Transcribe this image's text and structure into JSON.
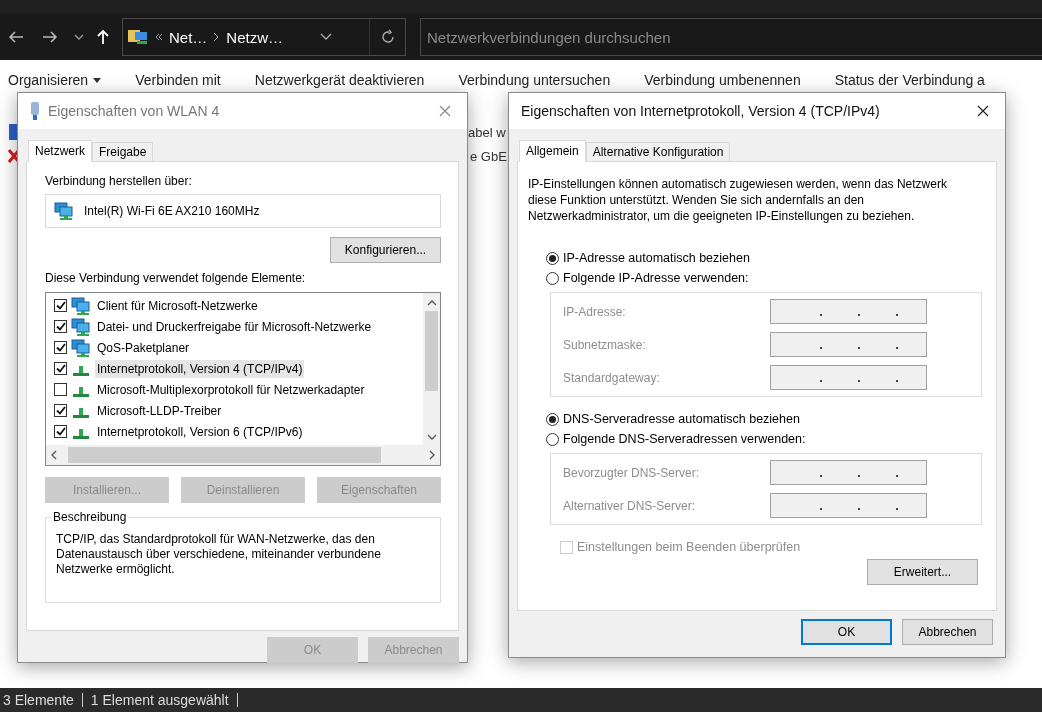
{
  "explorer": {
    "nav": {
      "breadcrumb": [
        "Net…",
        "Netzw…"
      ],
      "search_placeholder": "Netzwerkverbindungen durchsuchen"
    },
    "toolbar": [
      {
        "label": "Organisieren",
        "dropdown": true
      },
      {
        "label": "Verbinden mit",
        "dropdown": false
      },
      {
        "label": "Netzwerkgerät deaktivieren",
        "dropdown": false
      },
      {
        "label": "Verbindung untersuchen",
        "dropdown": false
      },
      {
        "label": "Verbindung umbenennen",
        "dropdown": false
      },
      {
        "label": "Status der Verbindung a",
        "dropdown": false
      }
    ],
    "file_list": [
      {
        "text": "abel w",
        "kind": "adapter"
      },
      {
        "text": "e GbE",
        "kind": "error"
      }
    ],
    "status_bar": [
      "3 Elemente",
      "1 Element ausgewählt"
    ]
  },
  "wlan_dialog": {
    "title": "Eigenschaften von WLAN 4",
    "tabs": [
      {
        "label": "Netzwerk",
        "selected": true
      },
      {
        "label": "Freigabe",
        "selected": false
      }
    ],
    "connect_label": "Verbindung herstellen über:",
    "adapter": "Intel(R) Wi-Fi 6E AX210 160MHz",
    "configure_button": "Konfigurieren...",
    "items_label": "Diese Verbindung verwendet folgende Elemente:",
    "items": [
      {
        "label": "Client für Microsoft-Netzwerke",
        "checked": true,
        "selected": false,
        "kind": "client"
      },
      {
        "label": "Datei- und Druckerfreigabe für Microsoft-Netzwerke",
        "checked": true,
        "selected": false,
        "kind": "service"
      },
      {
        "label": "QoS-Paketplaner",
        "checked": true,
        "selected": false,
        "kind": "service"
      },
      {
        "label": "Internetprotokoll, Version 4 (TCP/IPv4)",
        "checked": true,
        "selected": true,
        "kind": "protocol"
      },
      {
        "label": "Microsoft-Multiplexorprotokoll für Netzwerkadapter",
        "checked": false,
        "selected": false,
        "kind": "protocol"
      },
      {
        "label": "Microsoft-LLDP-Treiber",
        "checked": true,
        "selected": false,
        "kind": "protocol"
      },
      {
        "label": "Internetprotokoll, Version 6 (TCP/IPv6)",
        "checked": true,
        "selected": false,
        "kind": "protocol"
      }
    ],
    "action_buttons": [
      {
        "label": "Installieren...",
        "disabled": true
      },
      {
        "label": "Deinstallieren",
        "disabled": true
      },
      {
        "label": "Eigenschaften",
        "disabled": true
      }
    ],
    "description_title": "Beschreibung",
    "description": "TCP/IP, das Standardprotokoll für WAN-Netzwerke, das den Datenaustausch über verschiedene, miteinander verbundene Netzwerke ermöglicht.",
    "footer_buttons": [
      {
        "label": "OK",
        "disabled": true
      },
      {
        "label": "Abbrechen",
        "disabled": true
      }
    ]
  },
  "ipv4_dialog": {
    "title": "Eigenschaften von Internetprotokoll, Version 4 (TCP/IPv4)",
    "tabs": [
      {
        "label": "Allgemein",
        "selected": true
      },
      {
        "label": "Alternative Konfiguration",
        "selected": false
      }
    ],
    "intro": "IP-Einstellungen können automatisch zugewiesen werden, wenn das Netzwerk diese Funktion unterstützt. Wenden Sie sich andernfalls an den Netzwerkadministrator, um die geeigneten IP-Einstellungen zu beziehen.",
    "groups": [
      {
        "auto": {
          "label": "IP-Adresse automatisch beziehen",
          "selected": true
        },
        "manual": {
          "label": "Folgende IP-Adresse verwenden:",
          "selected": false
        },
        "disabled": true,
        "fields": [
          "IP-Adresse:",
          "Subnetzmaske:",
          "Standardgateway:"
        ]
      },
      {
        "auto": {
          "label": "DNS-Serveradresse automatisch beziehen",
          "selected": true
        },
        "manual": {
          "label": "Folgende DNS-Serveradressen verwenden:",
          "selected": false
        },
        "disabled": true,
        "fields": [
          "Bevorzugter DNS-Server:",
          "Alternativer DNS-Server:"
        ]
      }
    ],
    "validate": {
      "label": "Einstellungen beim Beenden überprüfen",
      "checked": false,
      "disabled": true
    },
    "advanced_button": "Erweitert...",
    "footer_buttons": [
      {
        "label": "OK",
        "default": true
      },
      {
        "label": "Abbrechen",
        "default": false
      }
    ]
  }
}
